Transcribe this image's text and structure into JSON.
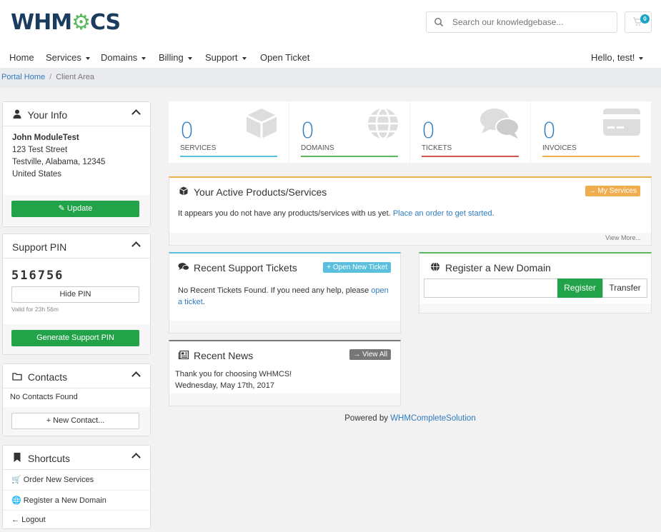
{
  "brand": {
    "logo_text_a": "WHM",
    "logo_text_b": "CS",
    "logo_gear": "⚙"
  },
  "search": {
    "placeholder": "Search our knowledgebase..."
  },
  "cart": {
    "count": "0"
  },
  "nav": {
    "items": [
      {
        "label": "Home"
      },
      {
        "label": "Services"
      },
      {
        "label": "Domains"
      },
      {
        "label": "Billing"
      },
      {
        "label": "Support"
      },
      {
        "label": "Open Ticket"
      }
    ],
    "user_greeting": "Hello, test!"
  },
  "breadcrumb": {
    "home": "Portal Home",
    "current": "Client Area"
  },
  "your_info": {
    "title": "Your Info",
    "name": "John ModuleTest",
    "address1": "123 Test Street",
    "address2": "Testville, Alabama, 12345",
    "country": "United States",
    "update_label": "Update"
  },
  "support_pin": {
    "title": "Support PIN",
    "pin": "516756",
    "hide_label": "Hide PIN",
    "valid_text": "Valid for 23h 56m",
    "generate_label": "Generate Support PIN"
  },
  "contacts": {
    "title": "Contacts",
    "empty_text": "No Contacts Found",
    "new_label": "+ New Contact..."
  },
  "shortcuts": {
    "title": "Shortcuts",
    "items": [
      {
        "label": "Order New Services"
      },
      {
        "label": "Register a New Domain"
      },
      {
        "label": "Logout"
      }
    ]
  },
  "stats": [
    {
      "value": "0",
      "label": "SERVICES",
      "color": "#5bc0de"
    },
    {
      "value": "0",
      "label": "DOMAINS",
      "color": "#5cb85c"
    },
    {
      "value": "0",
      "label": "TICKETS",
      "color": "#d9534f"
    },
    {
      "value": "0",
      "label": "INVOICES",
      "color": "#f0ad4e"
    }
  ],
  "products": {
    "title": "Your Active Products/Services",
    "button": "→ My Services",
    "text": "It appears you do not have any products/services with us yet.",
    "link": "Place an order to get started",
    "text_end": ".",
    "view_more": "View More..."
  },
  "tickets": {
    "title": "Recent Support Tickets",
    "button": "+ Open New Ticket",
    "text": "No Recent Tickets Found. If you need any help, please",
    "link": "open a ticket",
    "text_end": "."
  },
  "domain": {
    "title": "Register a New Domain",
    "register_label": "Register",
    "transfer_label": "Transfer"
  },
  "news": {
    "title": "Recent News",
    "button": "→ View All",
    "item_text": "Thank you for choosing WHMCS!",
    "item_date": "Wednesday, May 17th, 2017"
  },
  "footer": {
    "powered_by": "Powered by",
    "link": "WHMCompleteSolution"
  },
  "colors": {
    "accent_blue": "#2f7bbf",
    "green": "#23a349",
    "orange": "#f0ad4e",
    "teal": "#5bc0de"
  }
}
